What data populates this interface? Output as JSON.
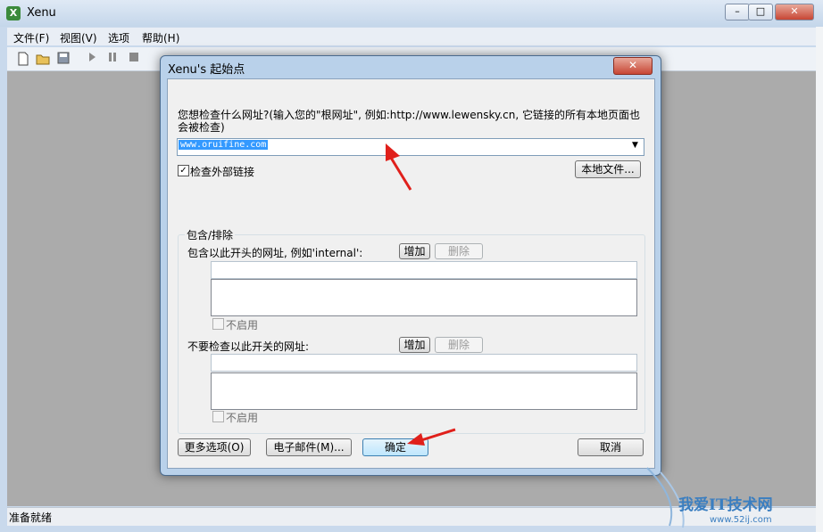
{
  "window": {
    "title": "Xenu",
    "app_icon_letter": "X",
    "minimize": "–",
    "maximize": "□",
    "close": "✕"
  },
  "menu": [
    {
      "label": "文件(F)"
    },
    {
      "label": "视图(V)"
    },
    {
      "label": "选项"
    },
    {
      "label": "帮助(H)"
    }
  ],
  "toolbar": [
    "new-icon",
    "open-icon",
    "save-icon",
    "play-icon",
    "pause-icon",
    "stop-icon"
  ],
  "status": {
    "text": "准备就绪"
  },
  "dialog": {
    "title": "Xenu's 起始点",
    "close": "✕",
    "prompt": "您想检查什么网址?(输入您的\"根网址\", 例如:http://www.lewensky.cn, 它链接的所有本地页面也会被检查)",
    "url_value": "www.oruifine.com",
    "url_dropdown": "▼",
    "check_external": {
      "label": "检查外部链接",
      "checked": true,
      "mark": "✓"
    },
    "local_file_button": "本地文件...",
    "group_label": "包含/排除",
    "include": {
      "label": "包含以此开头的网址, 例如'internal':",
      "add": "增加",
      "delete": "删除",
      "disable": "不启用"
    },
    "exclude": {
      "label": "不要检查以此开关的网址:",
      "add": "增加",
      "delete": "删除",
      "disable": "不启用"
    },
    "buttons": {
      "more": "更多选项(O)",
      "email": "电子邮件(M)...",
      "ok": "确定",
      "cancel": "取消"
    }
  },
  "watermark": {
    "text": "我爱IT技术网",
    "url": "www.52ij.com"
  },
  "colors": {
    "arrow": "#e0201b",
    "selection": "#3399ff",
    "titlebar": "#c4d6ea"
  }
}
